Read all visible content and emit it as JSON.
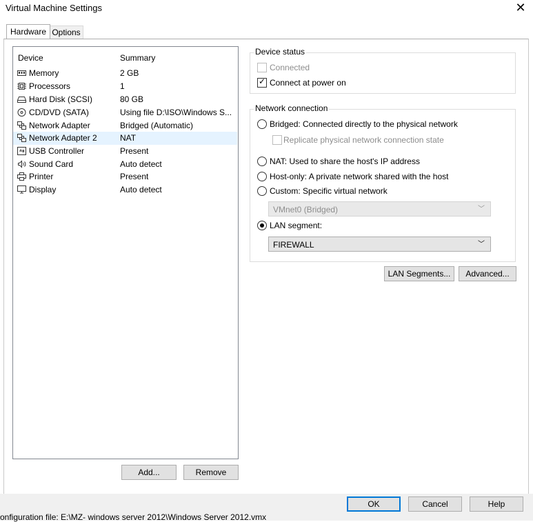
{
  "window": {
    "title": "Virtual Machine Settings",
    "close_glyph": "✕"
  },
  "tabs": [
    {
      "label": "Hardware",
      "active": true
    },
    {
      "label": "Options",
      "active": false
    }
  ],
  "device_list": {
    "headers": {
      "device": "Device",
      "summary": "Summary"
    },
    "rows": [
      {
        "icon": "memory-icon",
        "device": "Memory",
        "summary": "2 GB"
      },
      {
        "icon": "processor-icon",
        "device": "Processors",
        "summary": "1"
      },
      {
        "icon": "hard-disk-icon",
        "device": "Hard Disk (SCSI)",
        "summary": "80 GB"
      },
      {
        "icon": "cd-dvd-icon",
        "device": "CD/DVD (SATA)",
        "summary": "Using file D:\\ISO\\Windows S..."
      },
      {
        "icon": "network-adapter-icon",
        "device": "Network Adapter",
        "summary": "Bridged (Automatic)"
      },
      {
        "icon": "network-adapter-icon",
        "device": "Network Adapter 2",
        "summary": "NAT",
        "selected": true
      },
      {
        "icon": "usb-icon",
        "device": "USB Controller",
        "summary": "Present"
      },
      {
        "icon": "speaker-icon",
        "device": "Sound Card",
        "summary": "Auto detect"
      },
      {
        "icon": "printer-icon",
        "device": "Printer",
        "summary": "Present"
      },
      {
        "icon": "display-icon",
        "device": "Display",
        "summary": "Auto detect"
      }
    ],
    "add_label": "Add...",
    "remove_label": "Remove"
  },
  "device_status": {
    "legend": "Device status",
    "connected": {
      "label": "Connected",
      "checked": false,
      "enabled": false
    },
    "connect_at_power_on": {
      "label": "Connect at power on",
      "checked": true,
      "enabled": true
    }
  },
  "network_connection": {
    "legend": "Network connection",
    "bridged": {
      "label": "Bridged: Connected directly to the physical network",
      "selected": false
    },
    "replicate": {
      "label": "Replicate physical network connection state",
      "checked": false,
      "enabled": false
    },
    "nat": {
      "label": "NAT: Used to share the host's IP address",
      "selected": false
    },
    "host_only": {
      "label": "Host-only: A private network shared with the host",
      "selected": false
    },
    "custom": {
      "label": "Custom: Specific virtual network",
      "selected": false
    },
    "custom_select_value": "VMnet0 (Bridged)",
    "lan_segment": {
      "label": "LAN segment:",
      "selected": true
    },
    "lan_select_value": "FIREWALL",
    "lan_segments_button": "LAN Segments...",
    "advanced_button": "Advanced..."
  },
  "footer": {
    "ok_label": "OK",
    "cancel_label": "Cancel",
    "help_label": "Help",
    "config_text": "onfiguration file:  E:\\MZ- windows server 2012\\Windows Server 2012.vmx"
  },
  "colors": {
    "selection": "#e5f3ff",
    "default_button_border": "#0078d7",
    "disabled_text": "#8d8d8d"
  }
}
